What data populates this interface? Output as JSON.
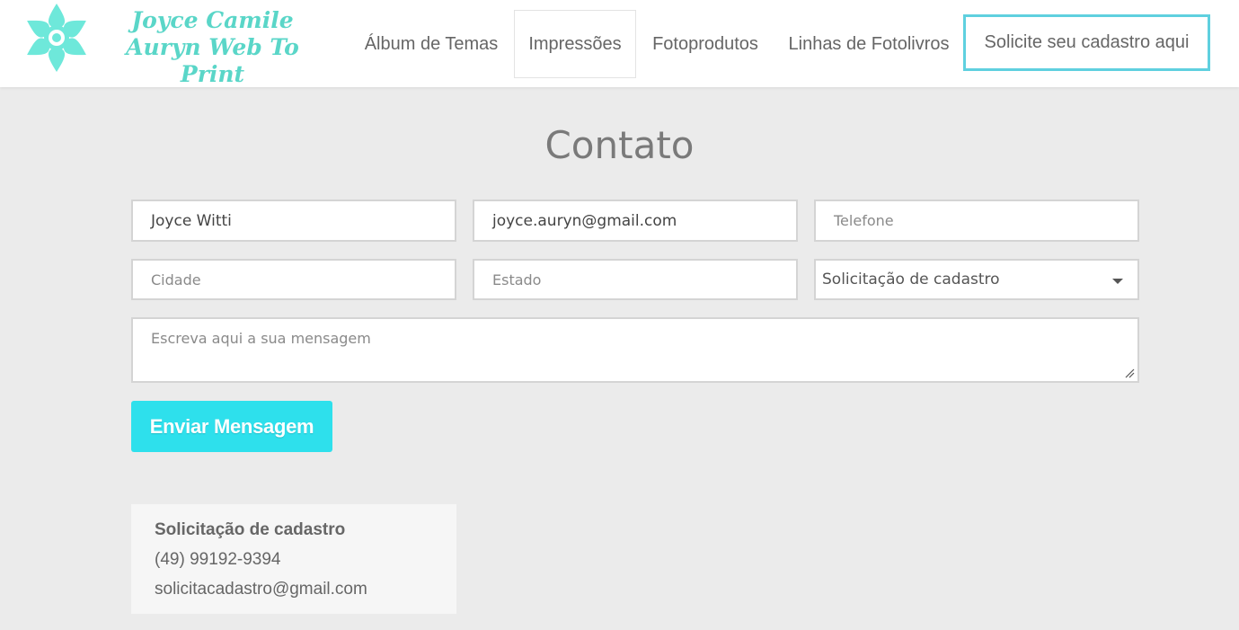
{
  "brand": {
    "logo_line1": "Joyce Camile",
    "logo_line2": "Auryn Web To Print",
    "logo_icon": "flower-icon",
    "color": "#5ad6c8"
  },
  "nav": {
    "items": [
      {
        "label": "Álbum de Temas"
      },
      {
        "label": "Impressões"
      },
      {
        "label": "Fotoprodutos"
      },
      {
        "label": "Linhas de Fotolivros"
      }
    ],
    "cta": "Solicite seu cadastro aqui",
    "active_index": 1,
    "cta_border_color": "#5fd0df"
  },
  "page": {
    "title": "Contato"
  },
  "form": {
    "name_value": "Joyce Witti",
    "email_value": "joyce.auryn@gmail.com",
    "phone_placeholder": "Telefone",
    "city_placeholder": "Cidade",
    "state_placeholder": "Estado",
    "subject_selected": "Solicitação de cadastro",
    "message_placeholder": "Escreva aqui a sua mensagem",
    "submit_label": "Enviar Mensagem",
    "submit_color": "#2ee0ec"
  },
  "contact_info": {
    "heading": "Solicitação de cadastro",
    "phone": "(49) 99192-9394",
    "email": "solicitacadastro@gmail.com"
  }
}
